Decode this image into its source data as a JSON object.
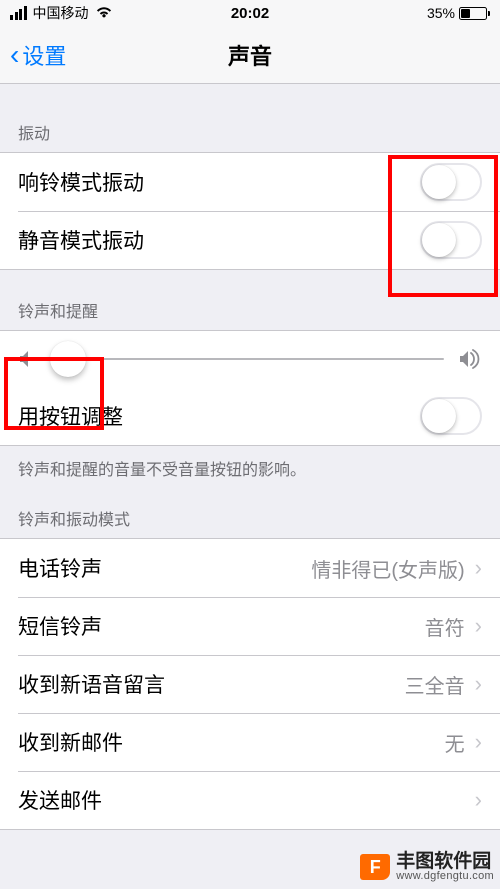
{
  "status": {
    "carrier": "中国移动",
    "time": "20:02",
    "battery_pct": "35%"
  },
  "nav": {
    "back_label": "设置",
    "title": "声音"
  },
  "sections": {
    "vibration": {
      "header": "振动",
      "ring_vibrate": "响铃模式振动",
      "silent_vibrate": "静音模式振动"
    },
    "ringer": {
      "header": "铃声和提醒",
      "button_adjust": "用按钮调整",
      "footer": "铃声和提醒的音量不受音量按钮的影响。"
    },
    "patterns": {
      "header": "铃声和振动模式",
      "items": [
        {
          "label": "电话铃声",
          "value": "情非得已(女声版)"
        },
        {
          "label": "短信铃声",
          "value": "音符"
        },
        {
          "label": "收到新语音留言",
          "value": "三全音"
        },
        {
          "label": "收到新邮件",
          "value": "无"
        },
        {
          "label": "发送邮件",
          "value": ""
        }
      ]
    }
  },
  "toggles": {
    "ring_vibrate": false,
    "silent_vibrate": false,
    "button_adjust": false
  },
  "slider": {
    "value_pct": 5
  },
  "watermark": {
    "brand": "丰图软件园",
    "domain": "www.dgfengtu.com",
    "logo_letter": "F"
  },
  "colors": {
    "accent": "#007aff",
    "highlight": "#ff0000",
    "wm_orange": "#ff6a00"
  }
}
